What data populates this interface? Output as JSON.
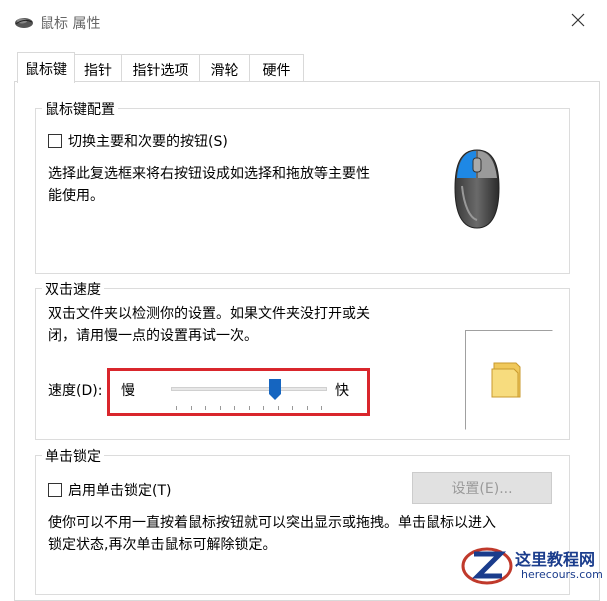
{
  "window": {
    "title": "鼠标 属性",
    "close_glyph": "✕"
  },
  "tabs": [
    {
      "label": "鼠标键",
      "active": true
    },
    {
      "label": "指针",
      "active": false
    },
    {
      "label": "指针选项",
      "active": false
    },
    {
      "label": "滑轮",
      "active": false
    },
    {
      "label": "硬件",
      "active": false
    }
  ],
  "button_config": {
    "legend": "鼠标键配置",
    "switch_checkbox_label": "切换主要和次要的按钮(S)",
    "switch_checked": false,
    "description_line1": "选择此复选框来将右按钮设成如选择和拖放等主要性",
    "description_line2": "能使用。"
  },
  "double_click": {
    "legend": "双击速度",
    "description_line1": "双击文件夹以检测你的设置。如果文件夹没打开或关",
    "description_line2": "闭，请用慢一点的设置再试一次。",
    "speed_label": "速度(D):",
    "slow_label": "慢",
    "fast_label": "快",
    "speed_value_fraction": 0.68
  },
  "click_lock": {
    "legend": "单击锁定",
    "checkbox_label": "启用单击锁定(T)",
    "checked": false,
    "settings_button": "设置(E)...",
    "settings_enabled": false,
    "description_line1": "使你可以不用一直按着鼠标按钮就可以突出显示或拖拽。单击鼠标以进入",
    "description_line2": "锁定状态,再次单击鼠标可解除锁定。"
  },
  "watermark": {
    "title": "这里教程网",
    "url": "herecours.com"
  },
  "colors": {
    "highlight": "#d9262c",
    "mouse_button_blue": "#1e88e5",
    "watermark_blue": "#1a3c8c"
  }
}
